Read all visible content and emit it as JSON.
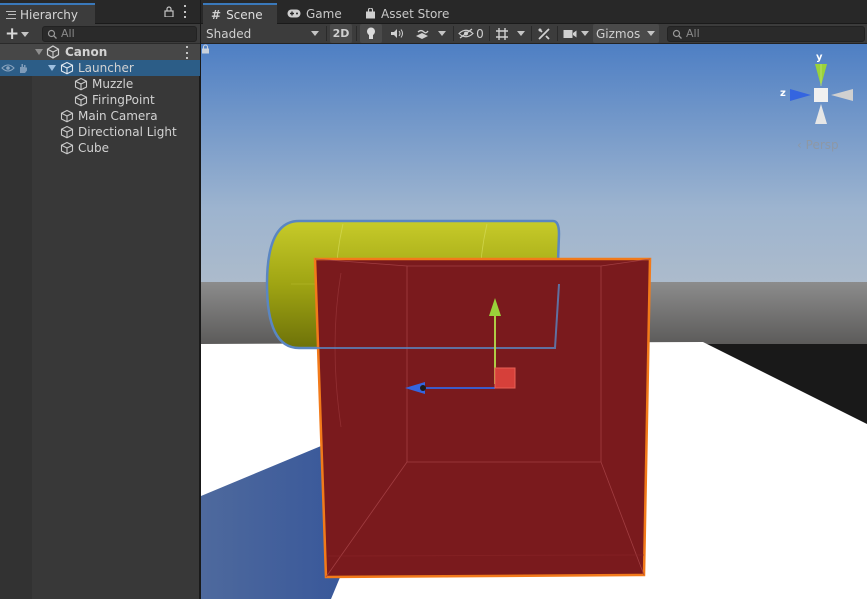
{
  "hierarchy": {
    "tab_label": "Hierarchy",
    "search_placeholder": "All",
    "add_label": "+",
    "items": [
      {
        "label": "Canon",
        "type": "scene"
      },
      {
        "label": "Launcher",
        "type": "object",
        "selected": true
      },
      {
        "label": "Muzzle",
        "type": "object"
      },
      {
        "label": "FiringPoint",
        "type": "object"
      },
      {
        "label": "Main Camera",
        "type": "object"
      },
      {
        "label": "Directional Light",
        "type": "object"
      },
      {
        "label": "Cube",
        "type": "object"
      }
    ]
  },
  "scene_tabs": [
    {
      "label": "Scene",
      "icon": "hash-icon",
      "active": true
    },
    {
      "label": "Game",
      "icon": "gamepad-icon",
      "active": false
    },
    {
      "label": "Asset Store",
      "icon": "bag-icon",
      "active": false
    }
  ],
  "scene_toolbar": {
    "shading_mode": "Shaded",
    "mode_2d": "2D",
    "hidden_count": "0",
    "gizmos": "Gizmos",
    "search_placeholder": "All"
  },
  "gizmo": {
    "axis_y": "y",
    "axis_z": "z",
    "projection": "Persp"
  },
  "colors": {
    "selection": "#2c5d87",
    "tab_accent": "#3a79bb",
    "cube_red": "#7a1a1d",
    "cylinder_yellow": "#a9ad16",
    "outline_orange": "#f27a1a",
    "outline_blue": "#5a86c2",
    "axis_y_green": "#9ad23a",
    "axis_x_red": "#d6403a",
    "axis_z_blue": "#3465e0"
  }
}
